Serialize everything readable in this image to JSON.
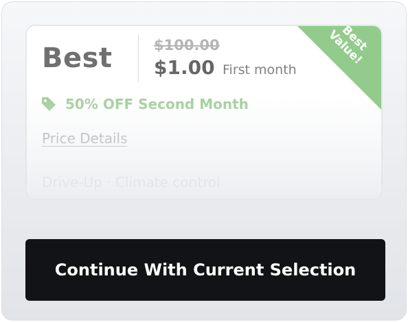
{
  "plan": {
    "tier_label": "Best",
    "original_price": "$100.00",
    "sale_price": "$1.00",
    "price_period": "First month",
    "promo_text": "50% OFF Second Month",
    "details_link": "Price Details",
    "features": "Drive-Up · Climate control",
    "ribbon_line1": "Best",
    "ribbon_line2": "Value!"
  },
  "actions": {
    "continue_label": "Continue With Current Selection"
  },
  "colors": {
    "ribbon": "#93cb8d",
    "promo": "#a2cf9a",
    "cta_background": "#121316"
  },
  "icons": {
    "promo_icon": "tag-icon"
  }
}
